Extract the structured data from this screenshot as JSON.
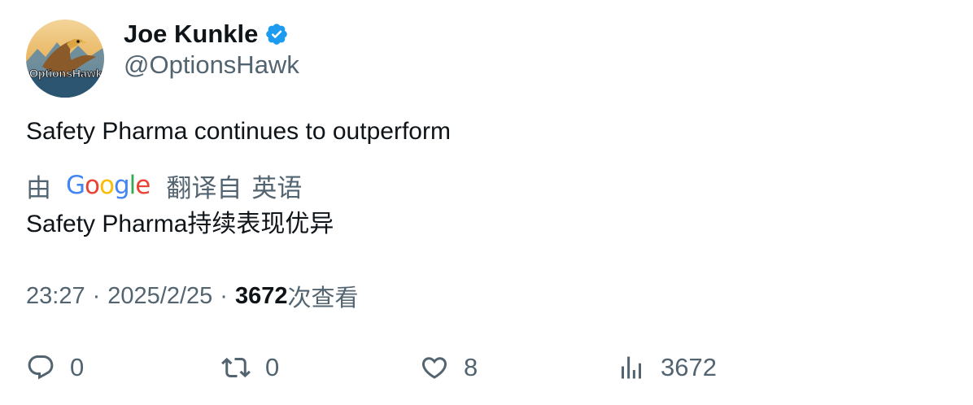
{
  "author": {
    "display_name": "Joe Kunkle",
    "handle": "@OptionsHawk",
    "avatar_text": "OptionsHawk",
    "verified": true,
    "verified_color": "#1d9bf0"
  },
  "tweet": {
    "text": "Safety Pharma continues to outperform"
  },
  "translation": {
    "by_label": "由",
    "provider": "Google",
    "from_label": "翻译自",
    "source_language": "英语",
    "translated_text": "Safety Pharma持续表现优异"
  },
  "meta": {
    "time": "23:27",
    "separator": "·",
    "date": "2025/2/25",
    "view_count": "3672",
    "views_label": "次查看"
  },
  "actions": {
    "reply": {
      "icon": "reply-icon",
      "count": "0"
    },
    "retweet": {
      "icon": "retweet-icon",
      "count": "0"
    },
    "like": {
      "icon": "heart-icon",
      "count": "8"
    },
    "views": {
      "icon": "bar-chart-icon",
      "count": "3672"
    }
  },
  "colors": {
    "text_primary": "#0f1419",
    "text_secondary": "#536471",
    "google_blue": "#4285F4",
    "google_red": "#EA4335",
    "google_yellow": "#FBBC05",
    "google_green": "#34A853"
  }
}
